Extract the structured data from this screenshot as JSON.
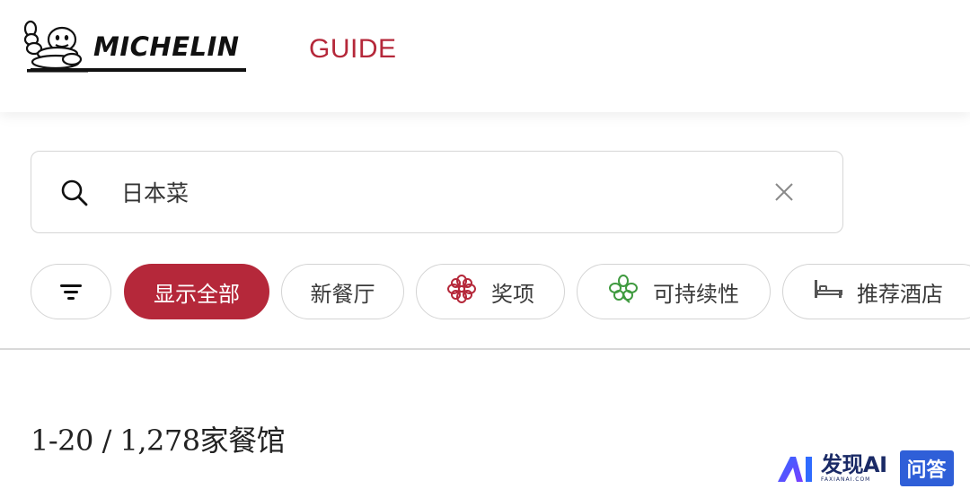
{
  "header": {
    "brand": "MICHELIN",
    "guide_label": "GUIDE"
  },
  "search": {
    "value": "日本菜",
    "search_icon": "search-icon",
    "clear_icon": "close-icon"
  },
  "filters": {
    "filter_icon": "filter-icon",
    "chips": [
      {
        "label": "显示全部",
        "active": true
      },
      {
        "label": "新餐厅",
        "active": false
      },
      {
        "label": "奖项",
        "icon": "michelin-flower-icon",
        "active": false
      },
      {
        "label": "可持续性",
        "icon": "green-clover-icon",
        "active": false
      },
      {
        "label": "推荐酒店",
        "icon": "bed-icon",
        "active": false
      }
    ]
  },
  "results": {
    "count_text": "1-20 / 1,278家餐馆"
  },
  "watermark": {
    "main": "发现AI",
    "sub": "FAXIANAI.COM",
    "badge": "问答"
  },
  "colors": {
    "accent": "#b5283a",
    "green": "#3f9a3f",
    "border": "#d4d4d4"
  }
}
